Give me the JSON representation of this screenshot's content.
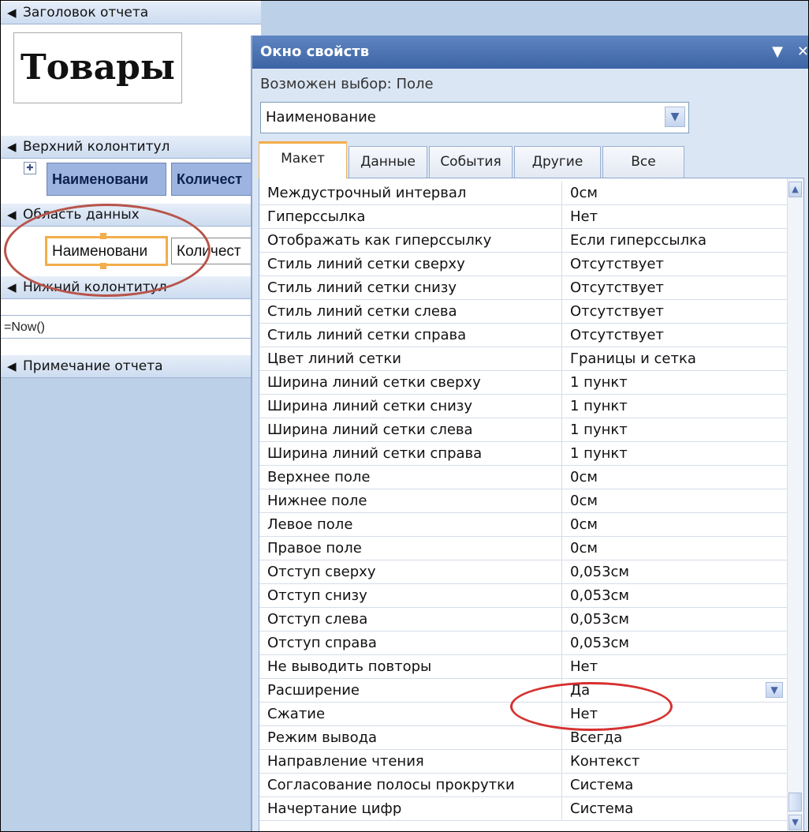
{
  "design": {
    "sections": {
      "report_header": "Заголовок отчета",
      "page_header": "Верхний колонтитул",
      "detail": "Область данных",
      "page_footer": "Нижний колонтитул",
      "report_footer": "Примечание отчета"
    },
    "title": "Товары",
    "header_fields": [
      "Наименовани",
      "Количест"
    ],
    "detail_fields": [
      "Наименовани",
      "Количест"
    ],
    "footer_expression": "=Now()"
  },
  "property_sheet": {
    "title": "Окно свойств",
    "selection_label": "Возможен выбор:",
    "selection_type": "Поле",
    "selected_control": "Наименование",
    "tabs": [
      "Макет",
      "Данные",
      "События",
      "Другие",
      "Все"
    ],
    "active_tab": "Макет",
    "rows": [
      {
        "name": "Междустрочный интервал",
        "value": "0см"
      },
      {
        "name": "Гиперссылка",
        "value": "Нет"
      },
      {
        "name": "Отображать как гиперссылку",
        "value": "Если гиперссылка"
      },
      {
        "name": "Стиль линий сетки сверху",
        "value": "Отсутствует"
      },
      {
        "name": "Стиль линий сетки снизу",
        "value": "Отсутствует"
      },
      {
        "name": "Стиль линий сетки слева",
        "value": "Отсутствует"
      },
      {
        "name": "Стиль линий сетки справа",
        "value": "Отсутствует"
      },
      {
        "name": "Цвет линий сетки",
        "value": "Границы и сетка"
      },
      {
        "name": "Ширина линий сетки сверху",
        "value": "1 пункт"
      },
      {
        "name": "Ширина линий сетки снизу",
        "value": "1 пункт"
      },
      {
        "name": "Ширина линий сетки слева",
        "value": "1 пункт"
      },
      {
        "name": "Ширина линий сетки справа",
        "value": "1 пункт"
      },
      {
        "name": "Верхнее поле",
        "value": "0см"
      },
      {
        "name": "Нижнее поле",
        "value": "0см"
      },
      {
        "name": "Левое поле",
        "value": "0см"
      },
      {
        "name": "Правое поле",
        "value": "0см"
      },
      {
        "name": "Отступ сверху",
        "value": "0,053см"
      },
      {
        "name": "Отступ снизу",
        "value": "0,053см"
      },
      {
        "name": "Отступ слева",
        "value": "0,053см"
      },
      {
        "name": "Отступ справа",
        "value": "0,053см"
      },
      {
        "name": "Не выводить повторы",
        "value": "Нет"
      },
      {
        "name": "Расширение",
        "value": "Да"
      },
      {
        "name": "Сжатие",
        "value": "Нет"
      },
      {
        "name": "Режим вывода",
        "value": "Всегда"
      },
      {
        "name": "Направление чтения",
        "value": "Контекст"
      },
      {
        "name": "Согласование полосы прокрутки",
        "value": "Система"
      },
      {
        "name": "Начертание цифр",
        "value": "Система"
      }
    ]
  },
  "colors": {
    "title_bar": "#3d64a3",
    "selection_outline": "#f3ad4b",
    "annotation_red": "#d63030",
    "design_background": "#bcd0e8"
  }
}
